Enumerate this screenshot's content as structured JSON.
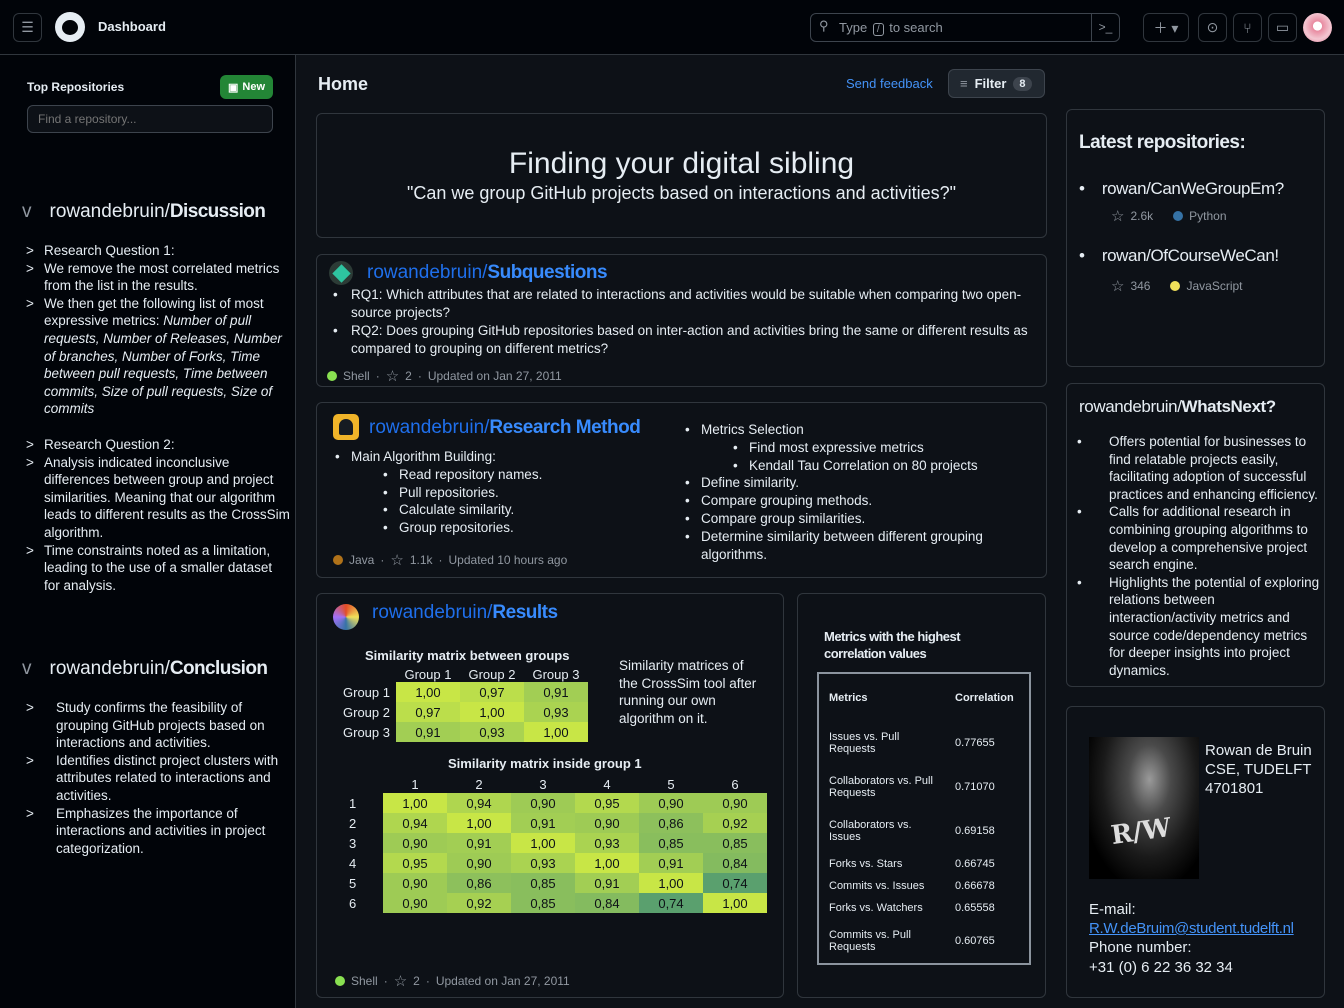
{
  "topbar": {
    "title": "Dashboard",
    "search_prefix": "Type",
    "search_key": "/",
    "search_suffix": "to search"
  },
  "sidebar": {
    "heading": "Top Repositories",
    "new_label": "New",
    "find_placeholder": "Find a repository...",
    "discussion": {
      "owner": "rowandebruin/",
      "name": "Discussion",
      "items": [
        "Research Question 1:",
        "We remove the most correlated metrics from the list in the results.",
        "We then get the following list of most expressive metrics: ",
        "Research Question 2:",
        "Analysis indicated inconclusive differences between group and project similarities. Meaning that our algorithm leads to different results as the CrossSim algorithm.",
        "Time constraints noted as a limitation, leading to the use of a smaller dataset for analysis."
      ],
      "metrics_italic": "Number of pull requests, Number of Releases, Number of branches, Number of Forks, Time between pull requests, Time between commits, Size of pull requests, Size of commits"
    },
    "conclusion": {
      "owner": "rowandebruin/",
      "name": "Conclusion",
      "items": [
        "Study confirms the feasibility of grouping GitHub projects based on interactions and activities.",
        "Identifies distinct project clusters with attributes related to interactions and activities.",
        "Emphasizes the importance of interactions and activities in project categorization."
      ]
    }
  },
  "main": {
    "home": "Home",
    "feedback": "Send feedback",
    "filter": "Filter",
    "filter_count": "8",
    "hero": {
      "title": "Finding your digital sibling",
      "subtitle": "\"Can we group GitHub projects based on interactions and activities?\""
    },
    "subq": {
      "owner": "rowandebruin/",
      "name": "Subquestions",
      "items": [
        "RQ1: Which attributes that are related to interactions and activities would be suitable when comparing two open-source projects?",
        "RQ2: Does grouping GitHub repositories based on inter-action and activities bring the same or different results as compared to grouping on different metrics?"
      ],
      "lang": "Shell",
      "stars": "2",
      "updated": "Updated on Jan 27, 2011",
      "lang_color": "#89e051"
    },
    "method": {
      "owner": "rowandebruin/",
      "name": "Research Method",
      "main": "Main Algorithm Building:",
      "main_sub": [
        "Read repository names.",
        "Pull repositories.",
        "Calculate similarity.",
        "Group repositories."
      ],
      "metrics": "Metrics Selection",
      "metrics_sub": [
        "Find most expressive metrics",
        "Kendall Tau Correlation on 80 projects"
      ],
      "right": [
        "Define similarity.",
        "Compare grouping methods.",
        "Compare group similarities.",
        "Determine similarity between different grouping algorithms."
      ],
      "lang": "Java",
      "stars": "1.1k",
      "updated": "Updated 10 hours ago",
      "lang_color": "#b07219"
    },
    "results": {
      "owner": "rowandebruin/",
      "name": "Results",
      "t1_title": "Similarity matrix between groups",
      "t1_headers": [
        "Group 1",
        "Group 2",
        "Group 3"
      ],
      "t1_rows": [
        [
          "Group 1",
          "1,00",
          "0,97",
          "0,91"
        ],
        [
          "Group 2",
          "0,97",
          "1,00",
          "0,93"
        ],
        [
          "Group 3",
          "0,91",
          "0,93",
          "1,00"
        ]
      ],
      "note": "Similarity matrices of the CrossSim tool after running our own algorithm on it.",
      "t2_title": "Similarity matrix inside group 1",
      "t2_headers": [
        "1",
        "2",
        "3",
        "4",
        "5",
        "6"
      ],
      "t2_rows": [
        [
          "1",
          "1,00",
          "0,94",
          "0,90",
          "0,95",
          "0,90",
          "0,90"
        ],
        [
          "2",
          "0,94",
          "1,00",
          "0,91",
          "0,90",
          "0,86",
          "0,92"
        ],
        [
          "3",
          "0,90",
          "0,91",
          "1,00",
          "0,93",
          "0,85",
          "0,85"
        ],
        [
          "4",
          "0,95",
          "0,90",
          "0,93",
          "1,00",
          "0,91",
          "0,84"
        ],
        [
          "5",
          "0,90",
          "0,86",
          "0,85",
          "0,91",
          "1,00",
          "0,74"
        ],
        [
          "6",
          "0,90",
          "0,92",
          "0,85",
          "0,84",
          "0,74",
          "1,00"
        ]
      ],
      "lang": "Shell",
      "stars": "2",
      "updated": "Updated on Jan 27, 2011",
      "lang_color": "#89e051"
    },
    "metrics": {
      "title": "Metrics with the highest correlation values",
      "h1": "Metrics",
      "h2": "Correlation",
      "rows": [
        [
          "Issues vs. Pull Requests",
          "0.77655"
        ],
        [
          "Collaborators vs. Pull Requests",
          "0.71070"
        ],
        [
          "Collaborators vs. Issues",
          "0.69158"
        ],
        [
          "Forks vs. Stars",
          "0.66745"
        ],
        [
          "Commits vs. Issues",
          "0.66678"
        ],
        [
          "Forks vs. Watchers",
          "0.65558"
        ],
        [
          "Commits vs. Pull Requests",
          "0.60765"
        ]
      ]
    }
  },
  "right": {
    "latest": {
      "title": "Latest repositories:",
      "repos": [
        {
          "name": "rowan/CanWeGroupEm?",
          "stars": "2.6k",
          "lang": "Python",
          "color": "#3572A5"
        },
        {
          "name": "rowan/OfCourseWeCan!",
          "stars": "346",
          "lang": "JavaScript",
          "color": "#f1e05a"
        }
      ]
    },
    "next": {
      "owner": "rowandebruin/",
      "name": "WhatsNext?",
      "items": [
        "Offers potential for businesses to find relatable projects easily, facilitating adoption of successful practices and enhancing efficiency.",
        "Calls for additional research in combining grouping algorithms to develop a comprehensive project search engine.",
        "Highlights the potential of exploring relations between interaction/activity metrics and source code/dependency metrics for deeper insights into project dynamics."
      ]
    },
    "profile": {
      "name": "Rowan de Bruin",
      "org": "CSE, TUDELFT",
      "id": "4701801",
      "email_label": "E-mail:",
      "email": "R.W.deBruim@student.tudelft.nl",
      "phone_label": "Phone number:",
      "phone": "+31 (0) 6 22 36 32 34"
    }
  }
}
